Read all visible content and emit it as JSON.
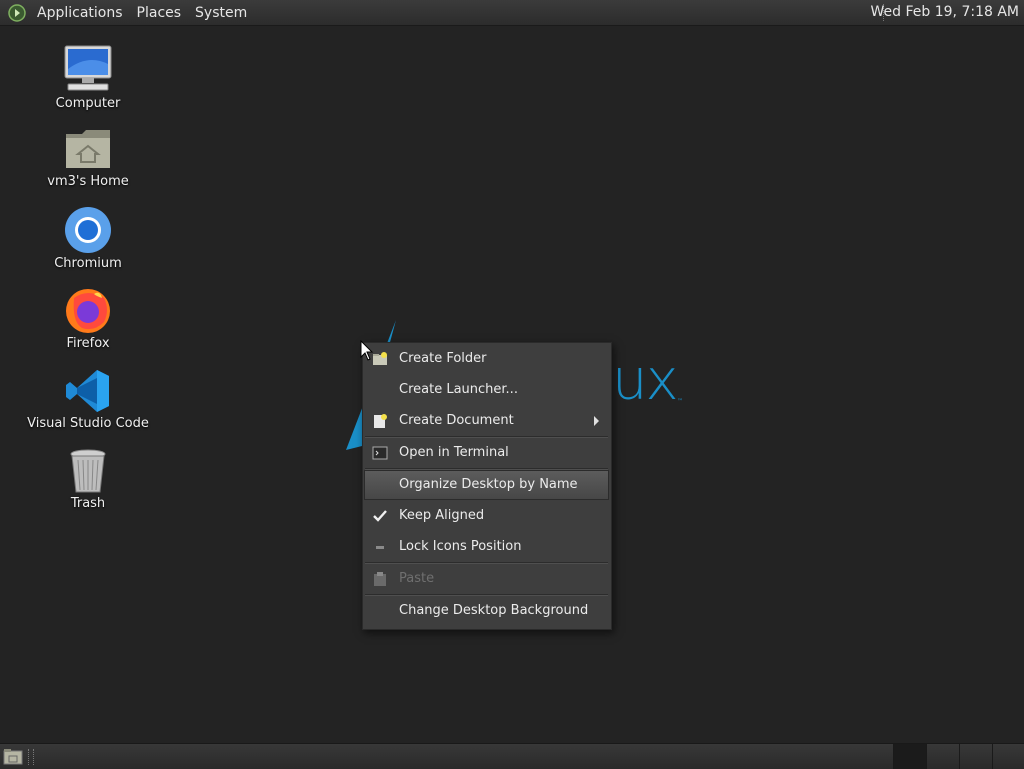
{
  "top_panel": {
    "menus": [
      "Applications",
      "Places",
      "System"
    ],
    "clock": "Wed Feb 19,  7:18 AM"
  },
  "desktop_icons": [
    {
      "label": "Computer",
      "icon": "computer-icon"
    },
    {
      "label": "vm3's Home",
      "icon": "home-folder-icon"
    },
    {
      "label": "Chromium",
      "icon": "chromium-icon"
    },
    {
      "label": "Firefox",
      "icon": "firefox-icon"
    },
    {
      "label": "Visual Studio Code",
      "icon": "vscode-icon"
    },
    {
      "label": "Trash",
      "icon": "trash-icon"
    }
  ],
  "wallpaper": {
    "logo_text": "ux",
    "brand_color": "#1a8fc8"
  },
  "context_menu": {
    "items": [
      {
        "label": "Create Folder",
        "icon": "new-folder-icon"
      },
      {
        "label": "Create Launcher...",
        "icon": ""
      },
      {
        "label": "Create Document",
        "icon": "new-document-icon",
        "submenu": true
      },
      {
        "label": "Open in Terminal",
        "icon": "terminal-icon"
      },
      {
        "label": "Organize Desktop by Name",
        "highlighted": true
      },
      {
        "label": "Keep Aligned",
        "icon": "checkmark-icon",
        "checked": true
      },
      {
        "label": "Lock Icons Position",
        "icon": "lock-dash-icon"
      },
      {
        "label": "Paste",
        "icon": "paste-icon",
        "disabled": true
      },
      {
        "label": "Change Desktop Background",
        "icon": ""
      }
    ]
  },
  "colors": {
    "desktop_bg": "#232323",
    "menu_bg": "#3e3e3e",
    "accent": "#1a8fc8"
  }
}
